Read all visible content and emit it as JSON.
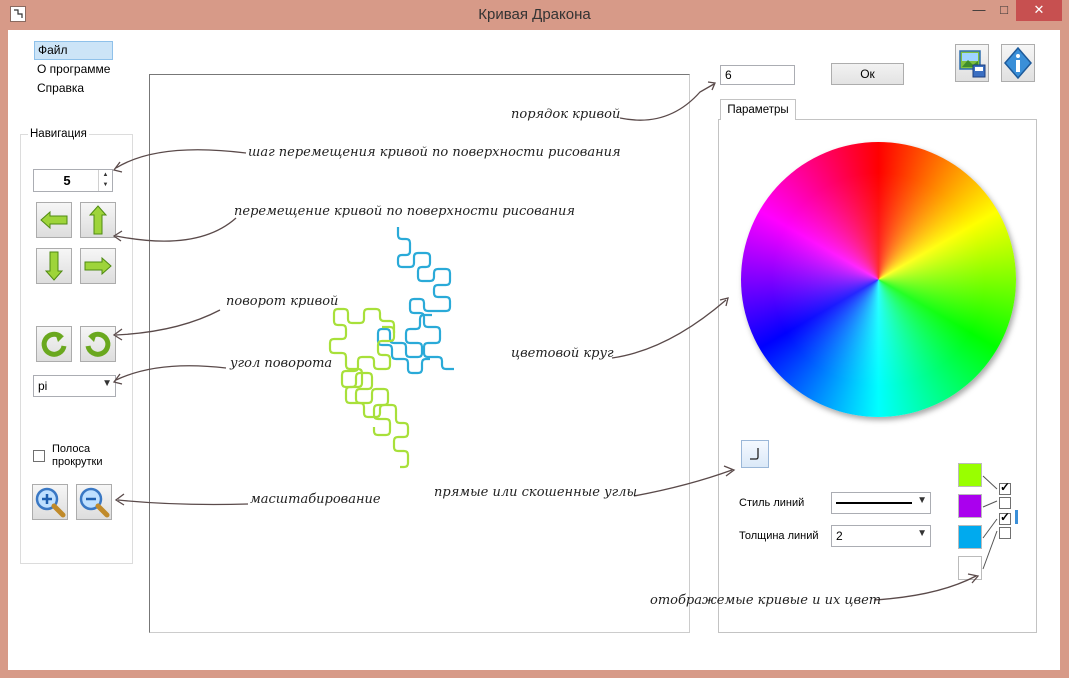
{
  "window": {
    "title": "Кривая Дракона",
    "buttons": {
      "minimize": "—",
      "maximize": "□",
      "close": "✕"
    },
    "close_color": "#c75050"
  },
  "menu": {
    "items": [
      "Файл",
      "О программе",
      "Справка"
    ]
  },
  "navigation": {
    "title": "Навигация",
    "step_value": "5",
    "icons": {
      "left": "arrow-left-icon",
      "up": "arrow-up-icon",
      "down": "arrow-down-icon",
      "right": "arrow-right-icon",
      "rotate_ccw": "rotate-ccw-icon",
      "rotate_cw": "rotate-cw-icon",
      "zoom_in": "zoom-in-icon",
      "zoom_out": "zoom-out-icon"
    },
    "angle_value": "pi",
    "scrollbar_label_1": "Полоса",
    "scrollbar_label_2": "прокрутки",
    "scrollbar_checked": false
  },
  "top_controls": {
    "order_value": "6",
    "ok_label": "Ок",
    "icons": {
      "save": "save-image-icon",
      "info": "info-icon"
    }
  },
  "params": {
    "tab_label": "Параметры",
    "line_style_label": "Стиль линий",
    "line_width_label": "Толщина линий",
    "line_width_value": "2",
    "corner_icon": "corner-style-icon",
    "curves": [
      {
        "color": "#99ff00",
        "checked": true
      },
      {
        "color": "#aa00ee",
        "checked": false
      },
      {
        "color": "#00aaee",
        "checked": true
      },
      {
        "color": "#ffffff",
        "checked": false
      }
    ]
  },
  "annotations": {
    "order": "порядок кривой",
    "step": "шаг перемещения кривой по поверхности рисования",
    "move": "перемещение кривой по поверхности рисования",
    "rotate": "поворот кривой",
    "angle": "угол поворота",
    "wheel": "цветовой круг",
    "corners": "прямые или скошенные углы",
    "scale": "масштабирование",
    "curves": "отображемые кривые и их цвет"
  }
}
